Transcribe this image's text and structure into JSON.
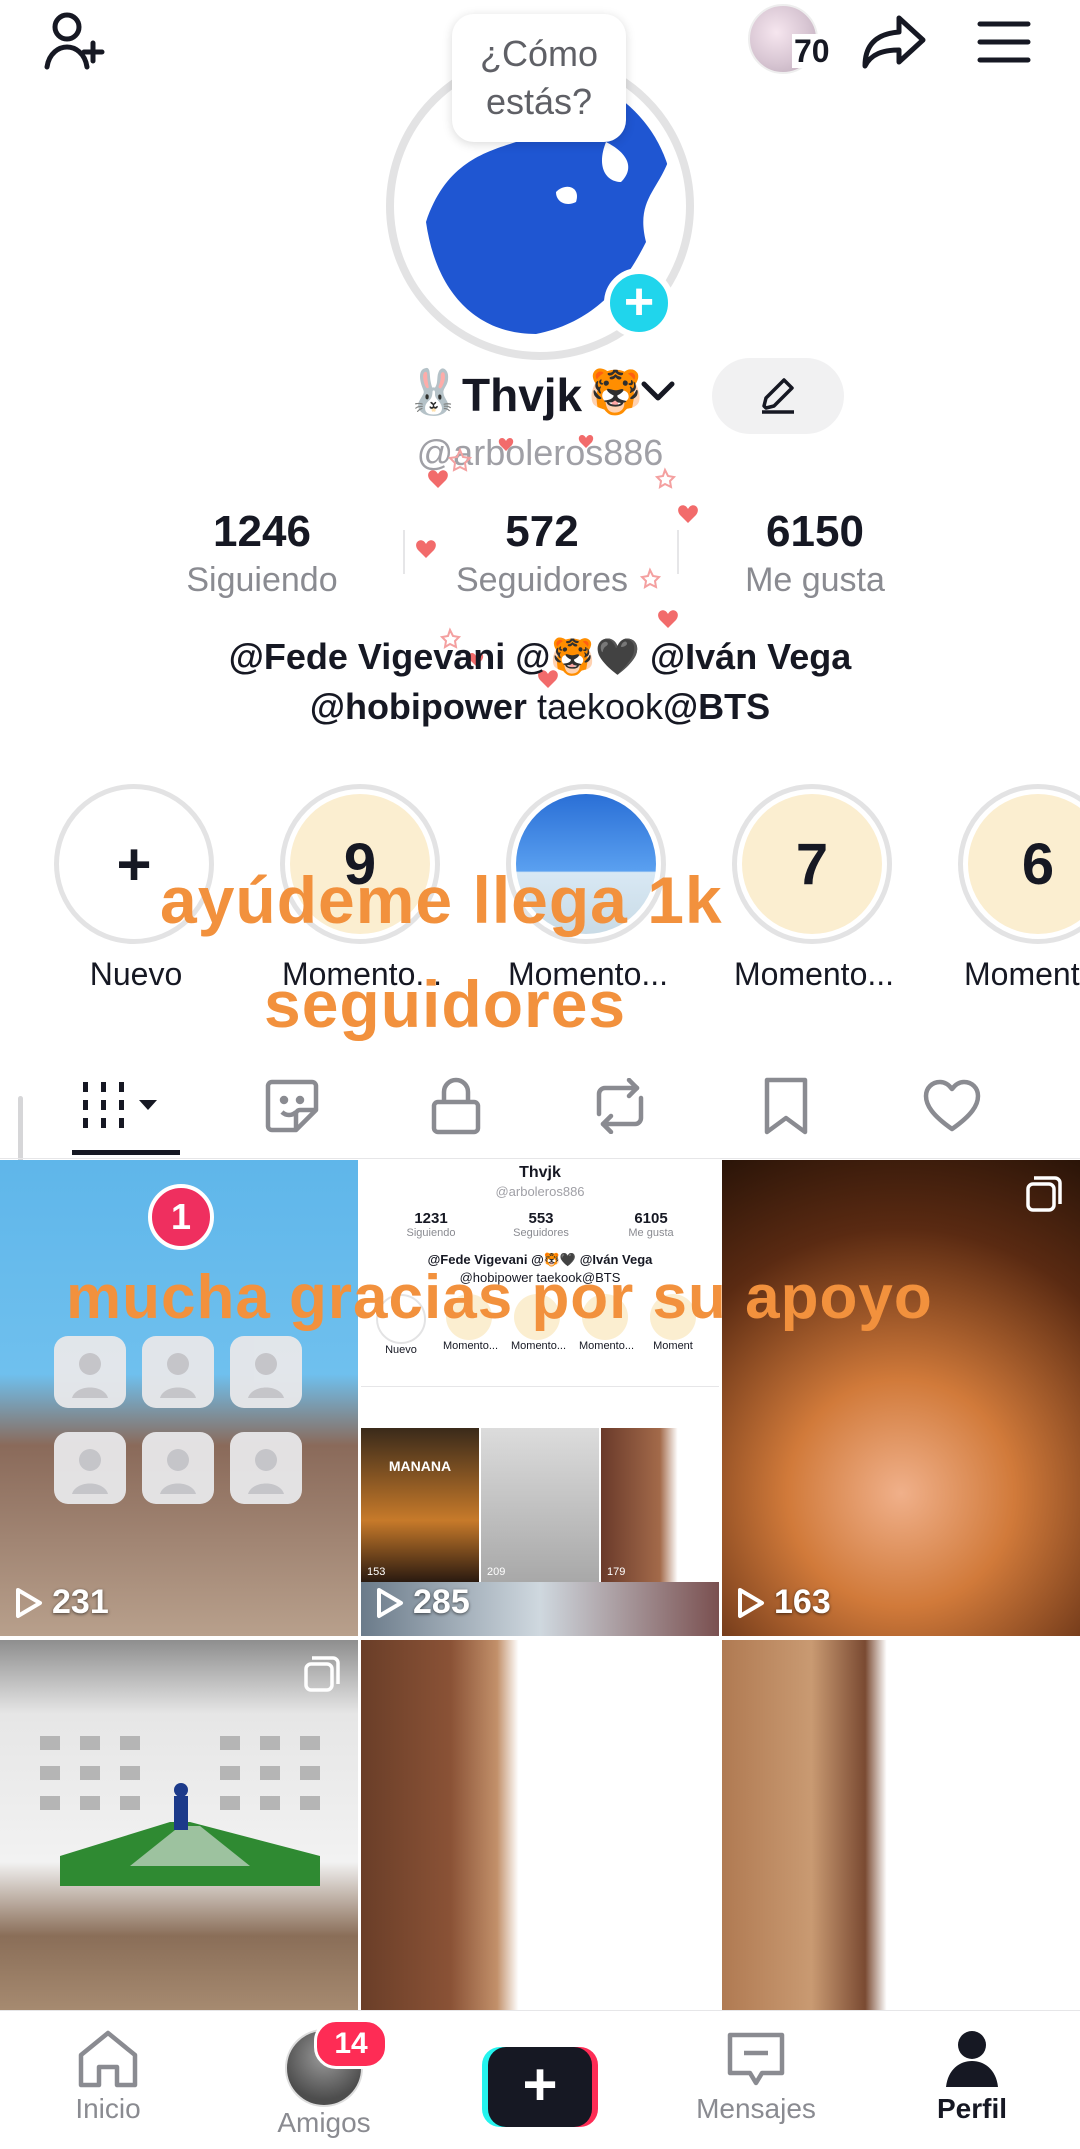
{
  "header": {
    "views_badge_count": "70",
    "bubble_text": "¿Cómo estás?"
  },
  "profile": {
    "display_name": "Thvjk",
    "username": "@arboleros886",
    "stats": [
      {
        "value": "1246",
        "label": "Siguiendo"
      },
      {
        "value": "572",
        "label": "Seguidores"
      },
      {
        "value": "6150",
        "label": "Me gusta"
      }
    ],
    "bio_line1": "@Fede Vigevani  @🐯🖤  @Iván Vega",
    "bio_line2_bold": "@hobipower",
    "bio_line2_mid": " taekook",
    "bio_line2_end": "@BTS"
  },
  "highlights": [
    {
      "label": "Nuevo",
      "badge": "+"
    },
    {
      "label": "Momento...",
      "badge": "9"
    },
    {
      "label": "Momento...",
      "badge": ""
    },
    {
      "label": "Momento...",
      "badge": "7"
    },
    {
      "label": "Moment",
      "badge": "6"
    }
  ],
  "overlays": {
    "line1": "ayúdeme llega 1k",
    "line2": "seguidores",
    "line3": "mucha gracias por su apoyo"
  },
  "tabs": [
    "videos",
    "reposts-stickers",
    "private",
    "reposts",
    "saved",
    "liked"
  ],
  "videos": [
    {
      "views": "231",
      "pin": "1"
    },
    {
      "views": "285"
    },
    {
      "views": "163"
    },
    {
      "views": ""
    },
    {
      "views": ""
    },
    {
      "views": ""
    }
  ],
  "embedded_screenshot": {
    "name": "Thvjk",
    "username": "@arboleros886",
    "stats": [
      {
        "value": "1231",
        "label": "Siguiendo"
      },
      {
        "value": "553",
        "label": "Seguidores"
      },
      {
        "value": "6105",
        "label": "Me gusta"
      }
    ],
    "bio1": "@Fede Vigevani  @🐯🖤  @Iván Vega",
    "bio2": "@hobipower taekook@BTS",
    "highlights": [
      "Nuevo",
      "Momento...",
      "Momento...",
      "Momento...",
      "Moment"
    ],
    "thumb_title": "MANANA",
    "thumb_views": [
      "153",
      "209",
      "179"
    ]
  },
  "bottom_nav": {
    "home": "Inicio",
    "friends": "Amigos",
    "friends_badge": "14",
    "messages": "Mensajes",
    "profile": "Perfil"
  }
}
